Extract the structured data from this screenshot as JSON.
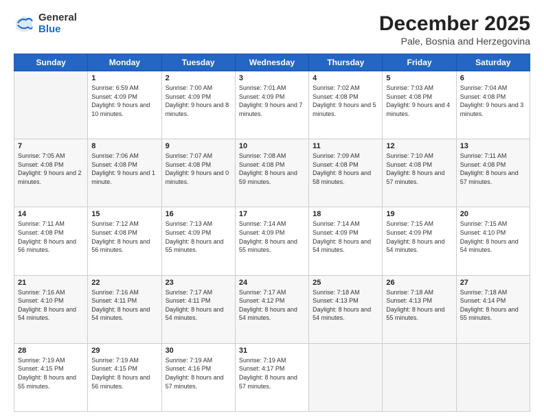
{
  "header": {
    "logo_general": "General",
    "logo_blue": "Blue",
    "title": "December 2025",
    "subtitle": "Pale, Bosnia and Herzegovina"
  },
  "columns": [
    "Sunday",
    "Monday",
    "Tuesday",
    "Wednesday",
    "Thursday",
    "Friday",
    "Saturday"
  ],
  "weeks": [
    [
      {
        "day": "",
        "sunrise": "",
        "sunset": "",
        "daylight": "",
        "empty": true
      },
      {
        "day": "1",
        "sunrise": "Sunrise: 6:59 AM",
        "sunset": "Sunset: 4:09 PM",
        "daylight": "Daylight: 9 hours and 10 minutes."
      },
      {
        "day": "2",
        "sunrise": "Sunrise: 7:00 AM",
        "sunset": "Sunset: 4:09 PM",
        "daylight": "Daylight: 9 hours and 8 minutes."
      },
      {
        "day": "3",
        "sunrise": "Sunrise: 7:01 AM",
        "sunset": "Sunset: 4:09 PM",
        "daylight": "Daylight: 9 hours and 7 minutes."
      },
      {
        "day": "4",
        "sunrise": "Sunrise: 7:02 AM",
        "sunset": "Sunset: 4:08 PM",
        "daylight": "Daylight: 9 hours and 5 minutes."
      },
      {
        "day": "5",
        "sunrise": "Sunrise: 7:03 AM",
        "sunset": "Sunset: 4:08 PM",
        "daylight": "Daylight: 9 hours and 4 minutes."
      },
      {
        "day": "6",
        "sunrise": "Sunrise: 7:04 AM",
        "sunset": "Sunset: 4:08 PM",
        "daylight": "Daylight: 9 hours and 3 minutes."
      }
    ],
    [
      {
        "day": "7",
        "sunrise": "Sunrise: 7:05 AM",
        "sunset": "Sunset: 4:08 PM",
        "daylight": "Daylight: 9 hours and 2 minutes."
      },
      {
        "day": "8",
        "sunrise": "Sunrise: 7:06 AM",
        "sunset": "Sunset: 4:08 PM",
        "daylight": "Daylight: 9 hours and 1 minute."
      },
      {
        "day": "9",
        "sunrise": "Sunrise: 7:07 AM",
        "sunset": "Sunset: 4:08 PM",
        "daylight": "Daylight: 9 hours and 0 minutes."
      },
      {
        "day": "10",
        "sunrise": "Sunrise: 7:08 AM",
        "sunset": "Sunset: 4:08 PM",
        "daylight": "Daylight: 8 hours and 59 minutes."
      },
      {
        "day": "11",
        "sunrise": "Sunrise: 7:09 AM",
        "sunset": "Sunset: 4:08 PM",
        "daylight": "Daylight: 8 hours and 58 minutes."
      },
      {
        "day": "12",
        "sunrise": "Sunrise: 7:10 AM",
        "sunset": "Sunset: 4:08 PM",
        "daylight": "Daylight: 8 hours and 57 minutes."
      },
      {
        "day": "13",
        "sunrise": "Sunrise: 7:11 AM",
        "sunset": "Sunset: 4:08 PM",
        "daylight": "Daylight: 8 hours and 57 minutes."
      }
    ],
    [
      {
        "day": "14",
        "sunrise": "Sunrise: 7:11 AM",
        "sunset": "Sunset: 4:08 PM",
        "daylight": "Daylight: 8 hours and 56 minutes."
      },
      {
        "day": "15",
        "sunrise": "Sunrise: 7:12 AM",
        "sunset": "Sunset: 4:08 PM",
        "daylight": "Daylight: 8 hours and 56 minutes."
      },
      {
        "day": "16",
        "sunrise": "Sunrise: 7:13 AM",
        "sunset": "Sunset: 4:09 PM",
        "daylight": "Daylight: 8 hours and 55 minutes."
      },
      {
        "day": "17",
        "sunrise": "Sunrise: 7:14 AM",
        "sunset": "Sunset: 4:09 PM",
        "daylight": "Daylight: 8 hours and 55 minutes."
      },
      {
        "day": "18",
        "sunrise": "Sunrise: 7:14 AM",
        "sunset": "Sunset: 4:09 PM",
        "daylight": "Daylight: 8 hours and 54 minutes."
      },
      {
        "day": "19",
        "sunrise": "Sunrise: 7:15 AM",
        "sunset": "Sunset: 4:09 PM",
        "daylight": "Daylight: 8 hours and 54 minutes."
      },
      {
        "day": "20",
        "sunrise": "Sunrise: 7:15 AM",
        "sunset": "Sunset: 4:10 PM",
        "daylight": "Daylight: 8 hours and 54 minutes."
      }
    ],
    [
      {
        "day": "21",
        "sunrise": "Sunrise: 7:16 AM",
        "sunset": "Sunset: 4:10 PM",
        "daylight": "Daylight: 8 hours and 54 minutes."
      },
      {
        "day": "22",
        "sunrise": "Sunrise: 7:16 AM",
        "sunset": "Sunset: 4:11 PM",
        "daylight": "Daylight: 8 hours and 54 minutes."
      },
      {
        "day": "23",
        "sunrise": "Sunrise: 7:17 AM",
        "sunset": "Sunset: 4:11 PM",
        "daylight": "Daylight: 8 hours and 54 minutes."
      },
      {
        "day": "24",
        "sunrise": "Sunrise: 7:17 AM",
        "sunset": "Sunset: 4:12 PM",
        "daylight": "Daylight: 8 hours and 54 minutes."
      },
      {
        "day": "25",
        "sunrise": "Sunrise: 7:18 AM",
        "sunset": "Sunset: 4:13 PM",
        "daylight": "Daylight: 8 hours and 54 minutes."
      },
      {
        "day": "26",
        "sunrise": "Sunrise: 7:18 AM",
        "sunset": "Sunset: 4:13 PM",
        "daylight": "Daylight: 8 hours and 55 minutes."
      },
      {
        "day": "27",
        "sunrise": "Sunrise: 7:18 AM",
        "sunset": "Sunset: 4:14 PM",
        "daylight": "Daylight: 8 hours and 55 minutes."
      }
    ],
    [
      {
        "day": "28",
        "sunrise": "Sunrise: 7:19 AM",
        "sunset": "Sunset: 4:15 PM",
        "daylight": "Daylight: 8 hours and 55 minutes."
      },
      {
        "day": "29",
        "sunrise": "Sunrise: 7:19 AM",
        "sunset": "Sunset: 4:15 PM",
        "daylight": "Daylight: 8 hours and 56 minutes."
      },
      {
        "day": "30",
        "sunrise": "Sunrise: 7:19 AM",
        "sunset": "Sunset: 4:16 PM",
        "daylight": "Daylight: 8 hours and 57 minutes."
      },
      {
        "day": "31",
        "sunrise": "Sunrise: 7:19 AM",
        "sunset": "Sunset: 4:17 PM",
        "daylight": "Daylight: 8 hours and 57 minutes."
      },
      {
        "day": "",
        "sunrise": "",
        "sunset": "",
        "daylight": "",
        "empty": true
      },
      {
        "day": "",
        "sunrise": "",
        "sunset": "",
        "daylight": "",
        "empty": true
      },
      {
        "day": "",
        "sunrise": "",
        "sunset": "",
        "daylight": "",
        "empty": true
      }
    ]
  ]
}
